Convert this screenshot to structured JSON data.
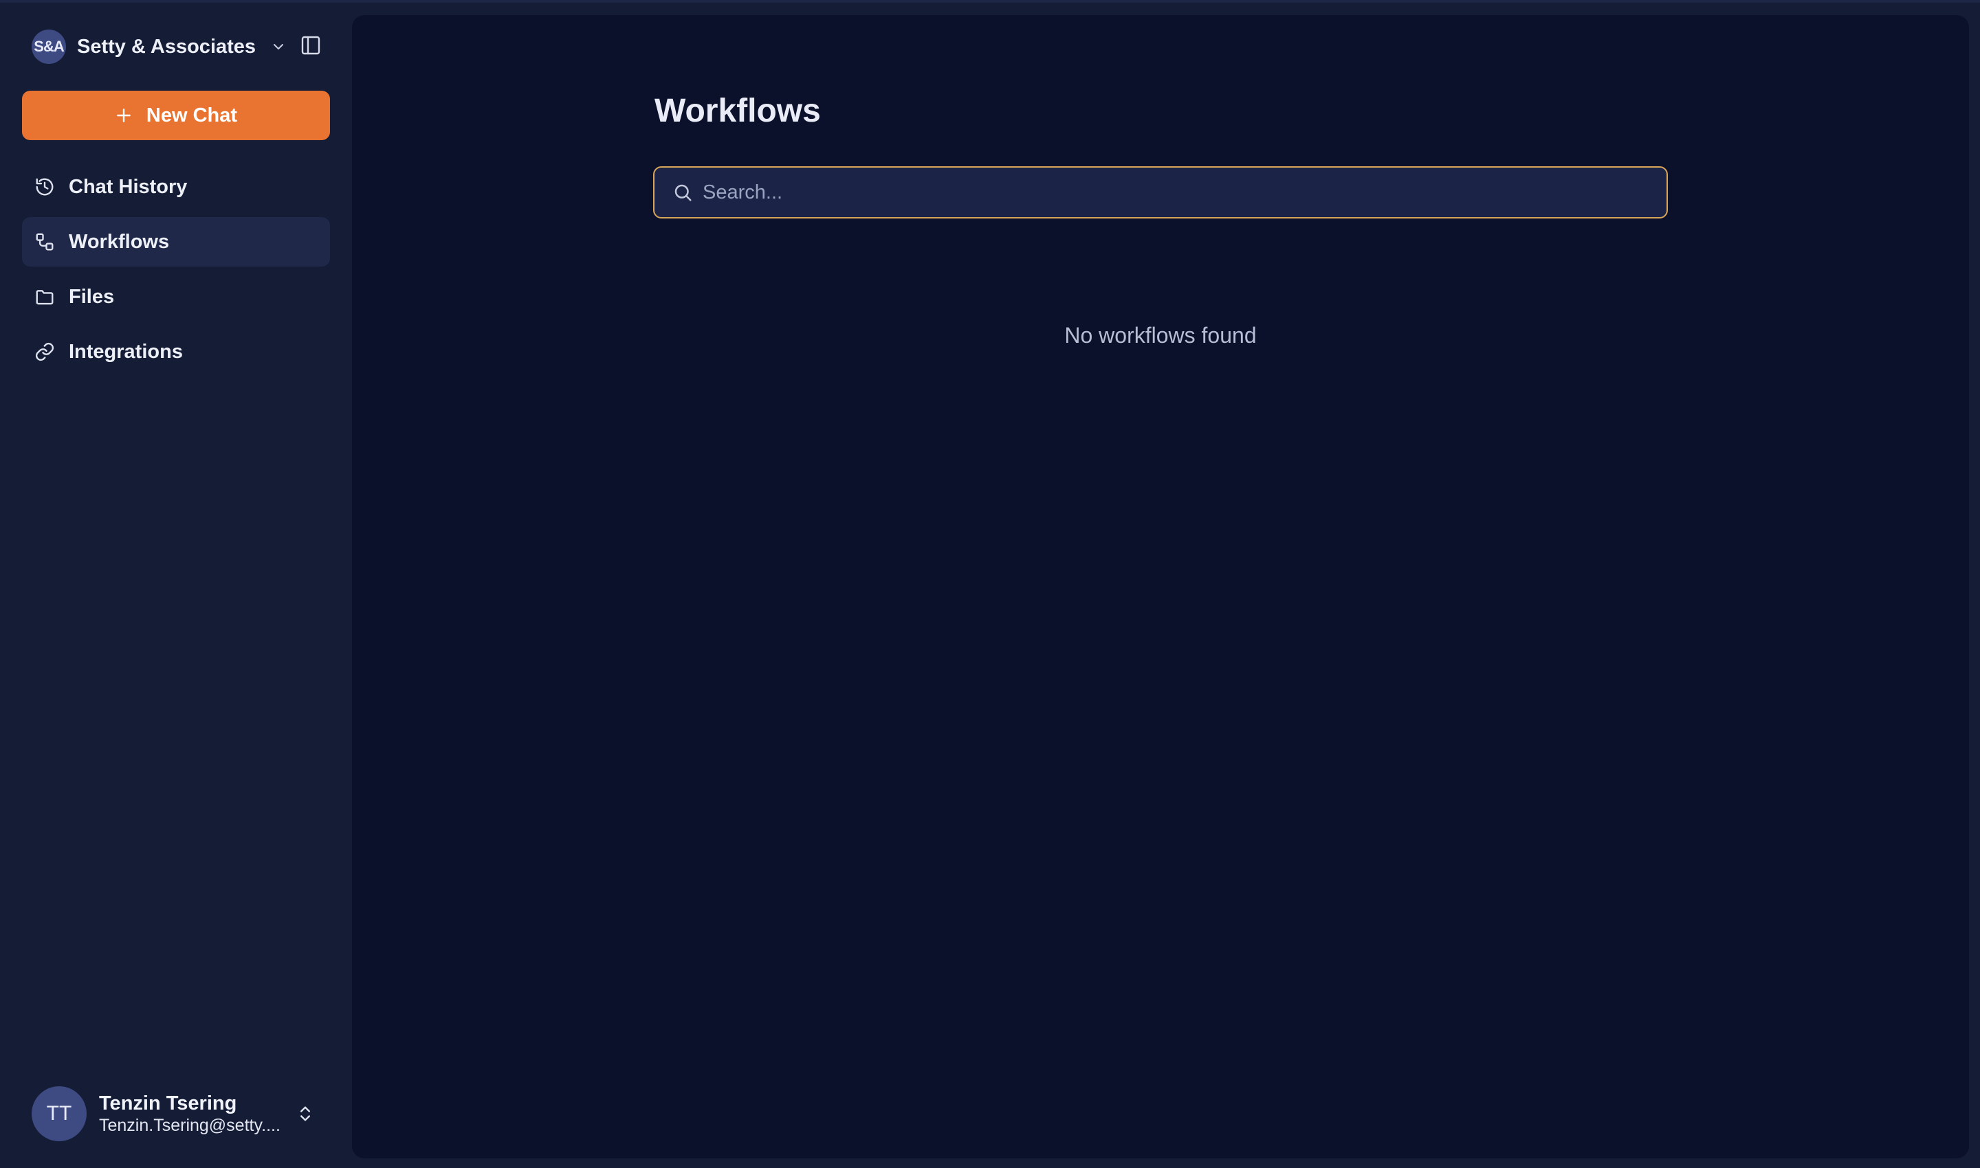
{
  "colors": {
    "accent": "#e97431",
    "search_focus_border": "#d9a65a",
    "sidebar_bg": "#151c36",
    "main_bg": "#0c112b",
    "active_item_bg": "#1f2848",
    "avatar_bg": "#3e4a82"
  },
  "sidebar": {
    "org": {
      "initials": "S&A",
      "name": "Setty & Associates",
      "dropdown_icon": "chevron-down-icon"
    },
    "collapse_icon": "sidebar-panel-icon",
    "new_chat": {
      "icon": "plus-icon",
      "label": "New Chat"
    },
    "items": [
      {
        "label": "Chat History",
        "icon": "history-icon",
        "active": false
      },
      {
        "label": "Workflows",
        "icon": "workflow-icon",
        "active": true
      },
      {
        "label": "Files",
        "icon": "folder-icon",
        "active": false
      },
      {
        "label": "Integrations",
        "icon": "link-icon",
        "active": false
      }
    ],
    "user": {
      "initials": "TT",
      "name": "Tenzin Tsering",
      "email": "Tenzin.Tsering@setty....",
      "switch_icon": "chevrons-up-down-icon"
    }
  },
  "main": {
    "title": "Workflows",
    "search": {
      "placeholder": "Search...",
      "value": ""
    },
    "empty_message": "No workflows found"
  }
}
